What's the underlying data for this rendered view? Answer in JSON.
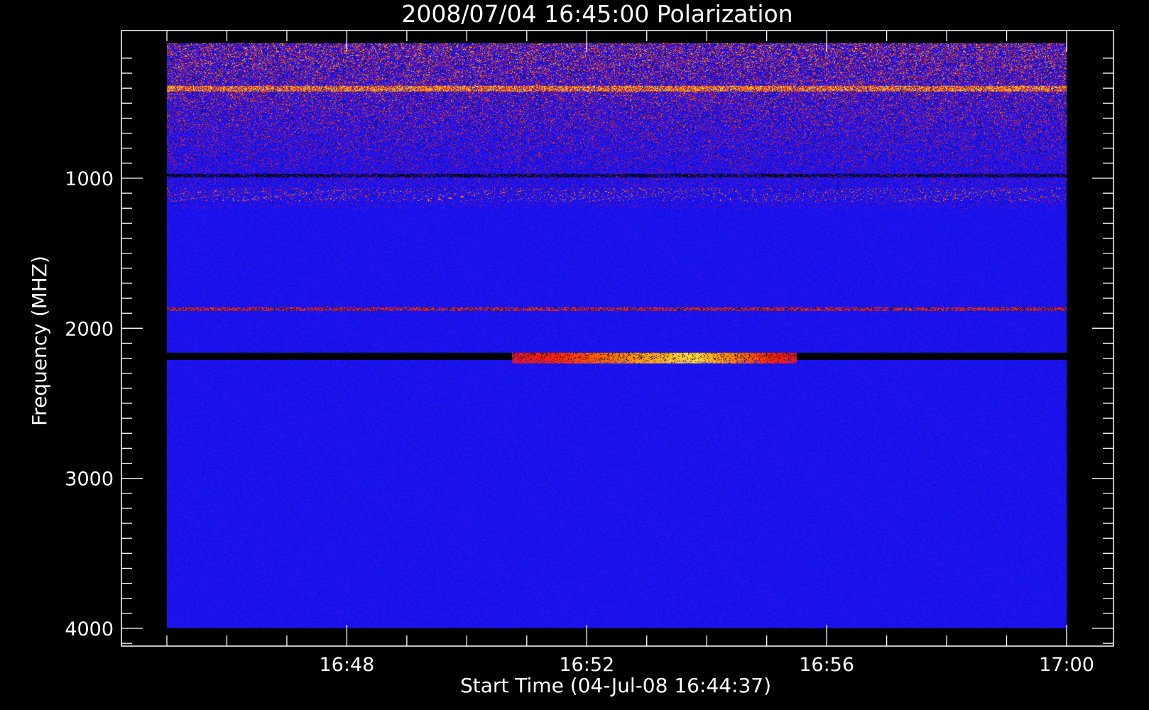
{
  "chart_data": {
    "type": "heatmap",
    "title": "2008/07/04 16:45:00 Polarization",
    "xlabel": "Start Time (04-Jul-08 16:44:37)",
    "ylabel": "Frequency (MHZ)",
    "x_tick_labels": [
      "16:48",
      "16:52",
      "16:56",
      "17:00"
    ],
    "y_tick_labels": [
      "1000",
      "2000",
      "3000",
      "4000"
    ],
    "y_ticks": [
      1000,
      2000,
      3000,
      4000
    ],
    "ylim": [
      4000,
      100
    ],
    "xlim": [
      "16:44:37",
      "17:01:00"
    ],
    "data_extent": {
      "freq": [
        100,
        4000
      ],
      "time": [
        "16:45:00",
        "17:00:00"
      ]
    },
    "colorscale": [
      "#000000",
      "#1414ff",
      "#b0106a",
      "#ff2200",
      "#ff9900",
      "#ffff66"
    ],
    "features": [
      {
        "kind": "noisy-band",
        "freq": [
          100,
          1200
        ],
        "intensity": 0.45
      },
      {
        "kind": "bright-line",
        "freq": 400,
        "intensity": 0.9
      },
      {
        "kind": "dark-line",
        "freq": 980,
        "intensity": 0.0
      },
      {
        "kind": "dotted-line",
        "freq": 1110,
        "intensity": 0.6
      },
      {
        "kind": "red-line",
        "freq": 1870,
        "intensity": 0.6
      },
      {
        "kind": "dark-band",
        "freq": [
          2160,
          2210
        ],
        "intensity": 0.0
      },
      {
        "kind": "burst",
        "freq": [
          2160,
          2230
        ],
        "time": [
          "16:50:45",
          "16:55:30"
        ],
        "peak_time": "16:53:45",
        "intensity": 1.0
      }
    ],
    "grid": false,
    "legend": "none"
  }
}
